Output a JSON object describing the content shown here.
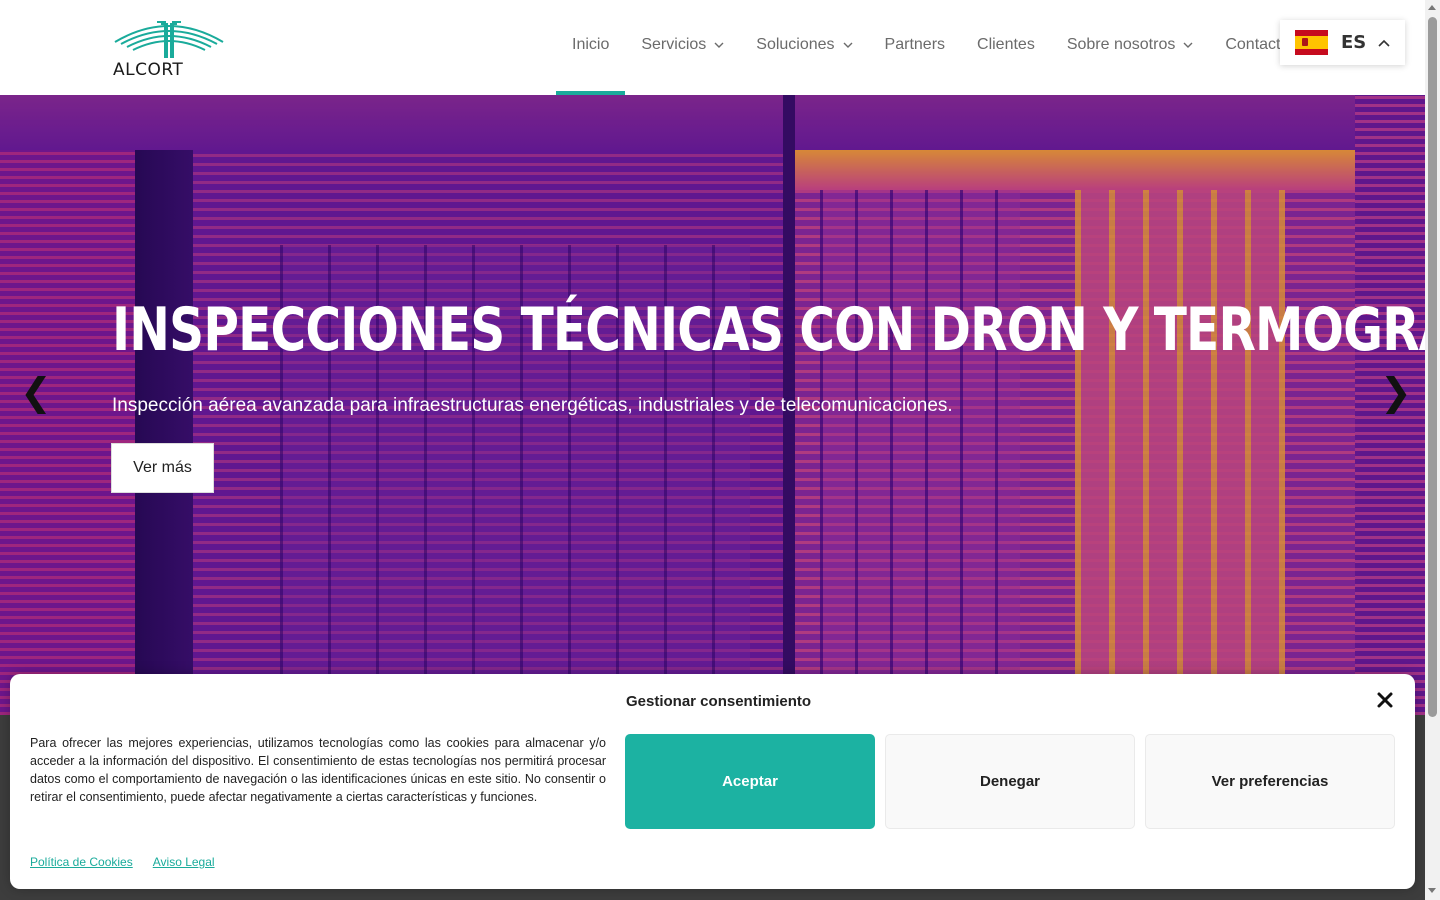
{
  "header": {
    "logo_text": "ALCORT",
    "nav": [
      {
        "label": "Inicio",
        "dropdown": false,
        "active": true
      },
      {
        "label": "Servicios",
        "dropdown": true
      },
      {
        "label": "Soluciones",
        "dropdown": true
      },
      {
        "label": "Partners",
        "dropdown": false
      },
      {
        "label": "Clientes",
        "dropdown": false
      },
      {
        "label": "Sobre nosotros",
        "dropdown": true
      },
      {
        "label": "Contacto",
        "dropdown": false
      }
    ],
    "language": {
      "code": "ES",
      "flag": "spain-flag-icon"
    }
  },
  "hero": {
    "title": "INSPECCIONES TÉCNICAS CON DRON Y TERMOGRAFÍA",
    "subtitle": "Inspección aérea avanzada para infraestructuras energéticas, industriales y de telecomunicaciones.",
    "button_label": "Ver más",
    "prev_arrow": "❮",
    "next_arrow": "❯"
  },
  "consent": {
    "title": "Gestionar consentimiento",
    "text": "Para ofrecer las mejores experiencias, utilizamos tecnologías como las cookies para almacenar y/o acceder a la información del dispositivo. El consentimiento de estas tecnologías nos permitirá procesar datos como el comportamiento de navegación o las identificaciones únicas en este sitio. No consentir o retirar el consentimiento, puede afectar negativamente a ciertas características y funciones.",
    "accept_label": "Aceptar",
    "deny_label": "Denegar",
    "preferences_label": "Ver preferencias",
    "links": {
      "cookies": "Política de Cookies",
      "legal": "Aviso Legal"
    }
  },
  "colors": {
    "accent": "#1aab9b",
    "accept_button": "#1cb2a2"
  }
}
